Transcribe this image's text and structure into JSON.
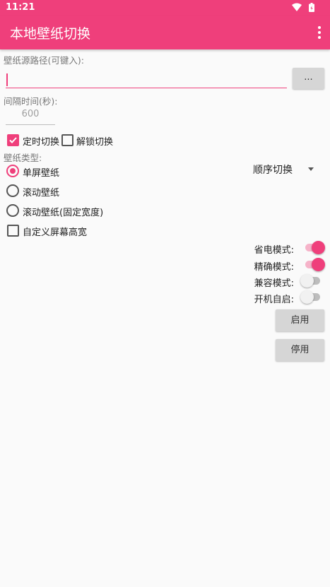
{
  "status": {
    "time": "11:21",
    "icons": [
      "wifi-icon",
      "battery-icon"
    ]
  },
  "appbar": {
    "title": "本地壁纸切换",
    "menu_icon": "more-vert-icon"
  },
  "source": {
    "label": "壁纸源路径(可键入):",
    "value": "",
    "browse_label": "..."
  },
  "interval": {
    "label": "间隔时间(秒):",
    "value": "600"
  },
  "switch_options": [
    {
      "label": "定时切换",
      "checked": true
    },
    {
      "label": "解锁切换",
      "checked": false
    }
  ],
  "wallpaper_type": {
    "label": "壁纸类型:",
    "options": [
      {
        "label": "单屏壁纸",
        "selected": true
      },
      {
        "label": "滚动壁纸",
        "selected": false
      },
      {
        "label": "滚动壁纸(固定宽度)",
        "selected": false
      }
    ],
    "order_select": "顺序切换"
  },
  "custom_screen": {
    "label": "自定义屏幕高宽",
    "checked": false
  },
  "modes": [
    {
      "label": "省电模式:",
      "on": true
    },
    {
      "label": "精确模式:",
      "on": true
    },
    {
      "label": "兼容模式:",
      "on": false
    },
    {
      "label": "开机自启:",
      "on": false
    }
  ],
  "buttons": {
    "enable": "启用",
    "disable": "停用"
  },
  "colors": {
    "accent": "#ef3f7b",
    "background": "#fafafa",
    "button": "#d6d6d6"
  }
}
